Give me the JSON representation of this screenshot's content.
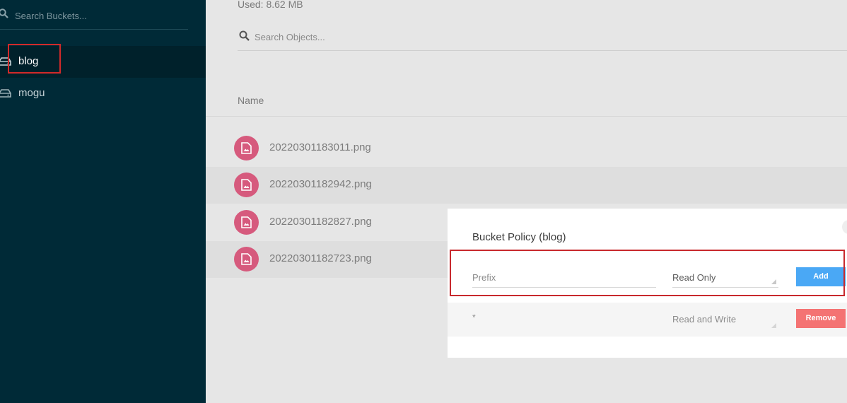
{
  "sidebar": {
    "search": {
      "placeholder": "Search Buckets...",
      "icon": "search-icon"
    },
    "buckets": [
      {
        "name": "blog",
        "active": true,
        "icon": "bucket-drive-icon"
      },
      {
        "name": "mogu",
        "active": false,
        "icon": "bucket-drive-icon"
      }
    ]
  },
  "main": {
    "used_label": "Used: 8.62 MB",
    "search": {
      "placeholder": "Search Objects...",
      "icon": "search-icon"
    },
    "table": {
      "column_name": "Name",
      "rows": [
        {
          "name": "20220301183011.png",
          "icon": "image-file-icon"
        },
        {
          "name": "20220301182942.png",
          "icon": "image-file-icon"
        },
        {
          "name": "20220301182827.png",
          "icon": "image-file-icon"
        },
        {
          "name": "20220301182723.png",
          "icon": "image-file-icon"
        }
      ]
    }
  },
  "modal": {
    "title": "Bucket Policy (blog)",
    "new_policy": {
      "prefix_placeholder": "Prefix",
      "permission": "Read Only",
      "add_label": "Add"
    },
    "policies": [
      {
        "prefix": "*",
        "permission": "Read and Write",
        "remove_label": "Remove"
      }
    ]
  },
  "colors": {
    "sidebar_bg": "#002a37",
    "file_icon": "#d65a7d",
    "add_button": "#4aa8f5",
    "remove_button": "#f47373",
    "highlight": "#d22a2a"
  }
}
